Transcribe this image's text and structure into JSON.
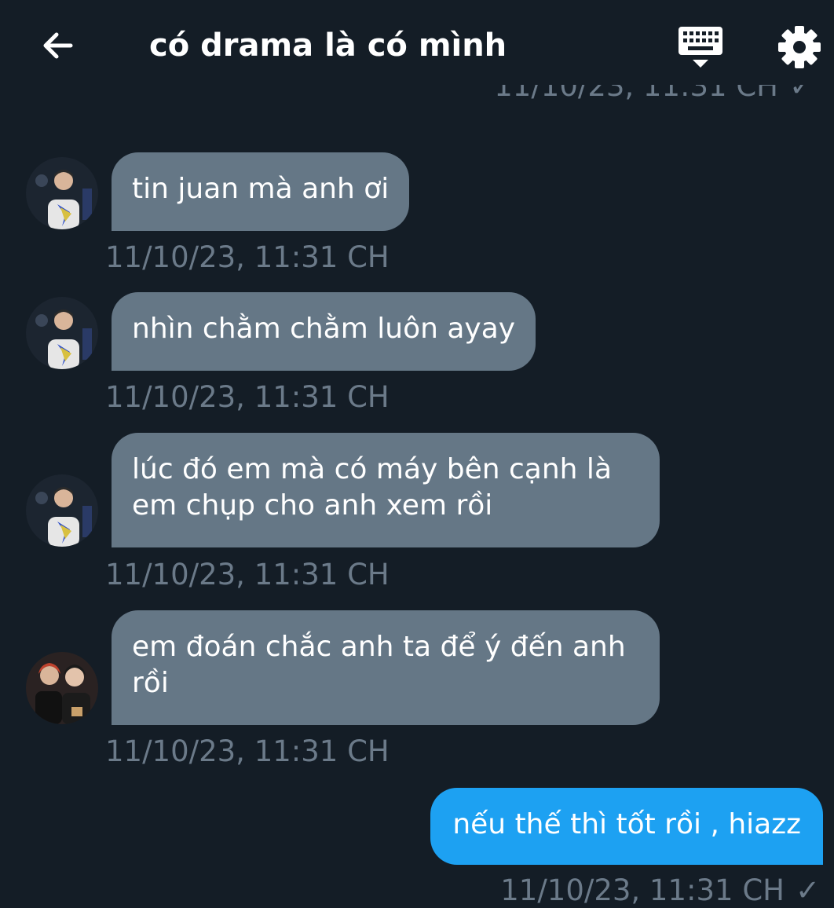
{
  "header": {
    "title": "có drama là có mình",
    "back_icon": "arrow-left-icon",
    "keyboard_icon": "keyboard-icon",
    "settings_icon": "gear-icon"
  },
  "colors": {
    "background": "#141d26",
    "incoming_bubble": "#657786",
    "outgoing_bubble": "#1da1f2",
    "timestamp": "#6b7a89"
  },
  "messages": {
    "previous_timestamp": "11/10/23, 11:31 CH",
    "previous_status": "✓",
    "items": [
      {
        "direction": "in",
        "sender_avatar": "avatar-1",
        "line1": "tin juan mà anh ơi",
        "line2": "",
        "timestamp": "11/10/23, 11:31 CH"
      },
      {
        "direction": "in",
        "sender_avatar": "avatar-1",
        "line1": "nhìn chằm chằm luôn ayay",
        "line2": "",
        "timestamp": "11/10/23, 11:31 CH"
      },
      {
        "direction": "in",
        "sender_avatar": "avatar-1",
        "line1": "lúc đó em mà có máy bên cạnh là",
        "line2": "em chụp cho anh xem rồi",
        "timestamp": "11/10/23, 11:31 CH"
      },
      {
        "direction": "in",
        "sender_avatar": "avatar-2",
        "line1": "em đoán chắc anh ta để ý đến anh",
        "line2": "rồi",
        "timestamp": "11/10/23, 11:31 CH"
      },
      {
        "direction": "out",
        "line1": "nếu thế thì tốt rồi , hiazz",
        "timestamp": "11/10/23, 11:31 CH",
        "status": "✓"
      }
    ]
  }
}
